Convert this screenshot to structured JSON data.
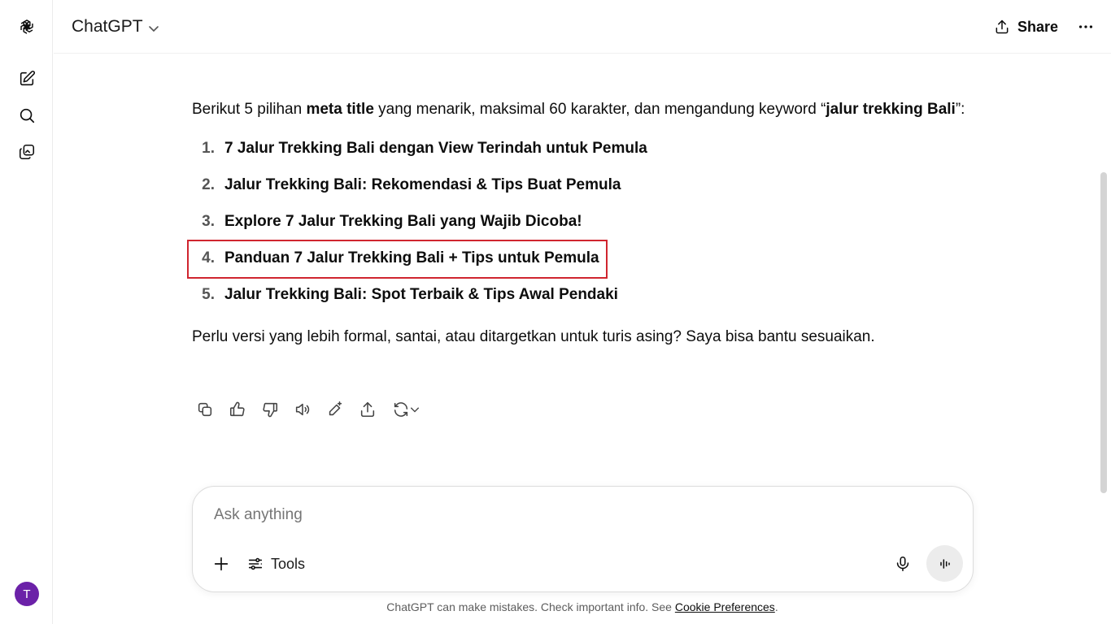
{
  "header": {
    "model_name": "ChatGPT",
    "share_label": "Share"
  },
  "message": {
    "intro_prefix": "Berikut 5 pilihan ",
    "intro_bold1": "meta title",
    "intro_mid": " yang menarik, maksimal 60 karakter, dan mengandung keyword “",
    "intro_bold2": "jalur trekking Bali",
    "intro_suffix": "”:",
    "items": [
      {
        "num": "1.",
        "text": "7 Jalur Trekking Bali dengan View Terindah untuk Pemula"
      },
      {
        "num": "2.",
        "text": "Jalur Trekking Bali: Rekomendasi & Tips Buat Pemula"
      },
      {
        "num": "3.",
        "text": "Explore 7 Jalur Trekking Bali yang Wajib Dicoba!"
      },
      {
        "num": "4.",
        "text": "Panduan 7 Jalur Trekking Bali + Tips untuk Pemula"
      },
      {
        "num": "5.",
        "text": "Jalur Trekking Bali: Spot Terbaik & Tips Awal Pendaki"
      }
    ],
    "outro": "Perlu versi yang lebih formal, santai, atau ditargetkan untuk turis asing? Saya bisa bantu sesuaikan."
  },
  "composer": {
    "placeholder": "Ask anything",
    "tools_label": "Tools"
  },
  "user": {
    "initial": "T",
    "avatar_color": "#6b21a8"
  },
  "footer": {
    "disclaimer": "ChatGPT can make mistakes. Check important info. See ",
    "link": "Cookie Preferences",
    "end": "."
  },
  "colors": {
    "highlight": "#d0252f"
  }
}
